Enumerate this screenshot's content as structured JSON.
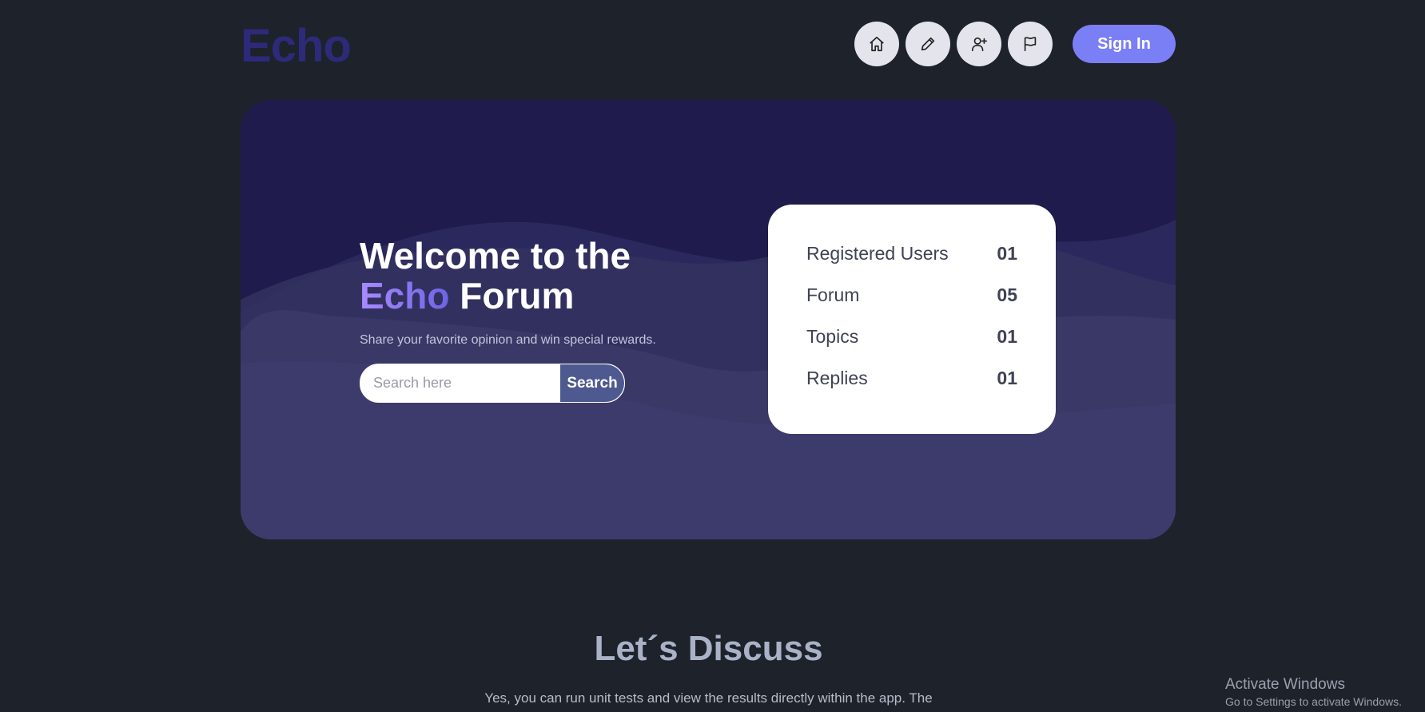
{
  "header": {
    "logo": "Echo",
    "nav": [
      {
        "icon": "home-icon"
      },
      {
        "icon": "pencil-icon"
      },
      {
        "icon": "user-plus-icon"
      },
      {
        "icon": "flag-icon"
      }
    ],
    "signin_label": "Sign In"
  },
  "hero": {
    "title_line1": "Welcome to the",
    "title_accent": "Echo",
    "title_rest": " Forum",
    "subtitle": "Share your favorite opinion and win special rewards.",
    "search": {
      "placeholder": "Search here",
      "button_label": "Search"
    },
    "stats": [
      {
        "label": "Registered Users",
        "value": "01"
      },
      {
        "label": "Forum",
        "value": "05"
      },
      {
        "label": "Topics",
        "value": "01"
      },
      {
        "label": "Replies",
        "value": "01"
      }
    ]
  },
  "discuss": {
    "title": "Let´s Discuss",
    "text": "Yes, you can run unit tests and view the results directly within the app. The"
  },
  "watermark": {
    "line1": "Activate Windows",
    "line2": "Go to Settings to activate Windows."
  },
  "colors": {
    "background": "#1e222a",
    "logo": "#2d2a7a",
    "accent": "#7b7ff5",
    "hero_dark": "#1f1b4d",
    "hero_light": "#3d3b6a",
    "search_button": "#4e5a8f"
  }
}
